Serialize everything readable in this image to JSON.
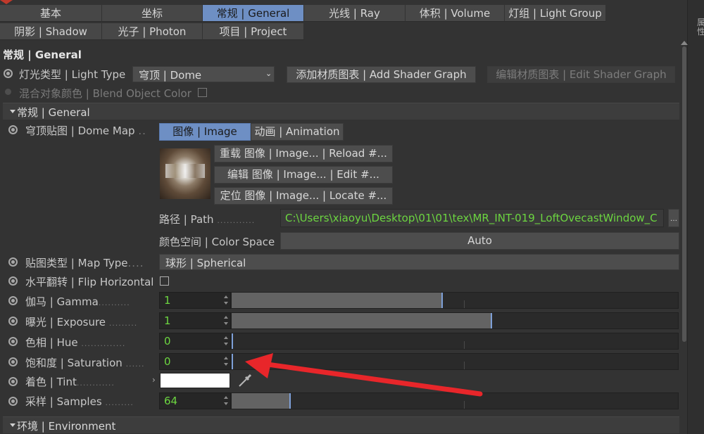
{
  "tabs_row1": [
    {
      "label": "基本",
      "active": false
    },
    {
      "label": "坐标",
      "active": false
    },
    {
      "label": "常规 | General",
      "active": true
    },
    {
      "label": "光线 | Ray",
      "active": false
    },
    {
      "label": "体积 | Volume",
      "active": false
    },
    {
      "label": "灯组 | Light Group",
      "active": false
    }
  ],
  "tabs_row2": [
    {
      "label": "阴影 | Shadow"
    },
    {
      "label": "光子 | Photon"
    },
    {
      "label": "项目 | Project"
    }
  ],
  "side_panel_text": "属性",
  "header": {
    "title": "常规 | General"
  },
  "light_type": {
    "label": "灯光类型 | Light Type",
    "value": "穹顶 | Dome"
  },
  "add_shader_graph": "添加材质图表 | Add Shader Graph",
  "edit_shader_graph": "编辑材质图表 | Edit Shader Graph",
  "blend_object_color": "混合对象颜色 | Blend Object Color",
  "section_general": "常规 | General",
  "dome_map": {
    "label": "穹顶贴图 | Dome Map",
    "dots": "..",
    "tab_image": "图像 | Image",
    "tab_animation": "动画 | Animation",
    "reload": "重载 图像 | Image... | Reload #...",
    "edit": "编辑 图像 | Image... | Edit #...",
    "locate": "定位 图像 | Image... | Locate #..."
  },
  "path": {
    "label": "路径 | Path",
    "dots": "............",
    "value": "C:\\Users\\xiaoyu\\Desktop\\01\\01\\tex\\MR_INT-019_LoftOvecastWindow_C"
  },
  "color_space": {
    "label": "颜色空间 | Color Space",
    "value": "Auto"
  },
  "map_type": {
    "label": "贴图类型 | Map Type",
    "dots": "....",
    "value": "球形 | Spherical"
  },
  "flip_horizontal": {
    "label": "水平翻转 | Flip Horizontal"
  },
  "gamma": {
    "label": "伽马 | Gamma",
    "dots": "..........",
    "value": "1",
    "fill_fraction": 0.47
  },
  "exposure": {
    "label": "曝光 | Exposure",
    "dots": ".........",
    "value": "1",
    "fill_fraction": 0.58
  },
  "hue": {
    "label": "色相 | Hue",
    "dots": "..............",
    "value": "0",
    "fill_fraction": 0.0
  },
  "saturation": {
    "label": "饱和度 | Saturation",
    "dots": "......",
    "value": "0",
    "fill_fraction": 0.0
  },
  "tint": {
    "label": "着色 | Tint",
    "dots": "............",
    "color": "#ffffff"
  },
  "samples": {
    "label": "采样 | Samples",
    "dots": ".........",
    "value": "64",
    "fill_fraction": 0.13
  },
  "section_environment": "环境 | Environment",
  "colors": {
    "accent": "#6e8fc4",
    "value_green": "#6cd640",
    "arrow_red": "#e8262a",
    "background": "#333333"
  }
}
